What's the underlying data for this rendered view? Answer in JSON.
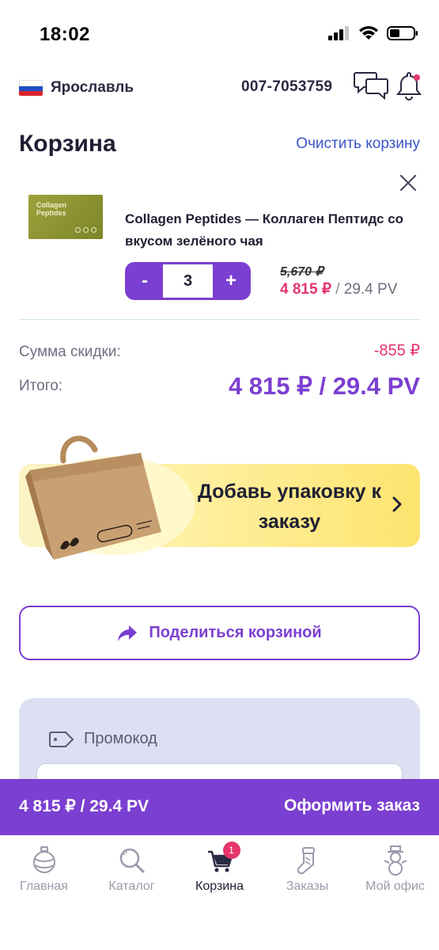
{
  "status_bar": {
    "time": "18:02"
  },
  "header": {
    "city": "Ярославль",
    "phone": "007-7053759"
  },
  "cart": {
    "title": "Корзина",
    "clear_label": "Очистить корзину",
    "item": {
      "thumb_text": "Collagen Peptides",
      "name": "Collagen Peptides — Коллаген Пептидс со вкусом зелёного чая",
      "quantity": "3",
      "minus_label": "-",
      "plus_label": "+",
      "old_price": "5,670 ₽",
      "price": "4 815 ₽",
      "price_separator": " / ",
      "pv": "29.4 PV"
    },
    "discount_label": "Сумма скидки:",
    "discount_value": "-855 ₽",
    "total_label": "Итого:",
    "total_value": "4 815 ₽ / 29.4 PV"
  },
  "package_banner": {
    "text": "Добавь упаковку к заказу"
  },
  "share": {
    "label": "Поделиться корзиной"
  },
  "promo": {
    "label": "Промокод",
    "value": ""
  },
  "checkout": {
    "total": "4 815 ₽ / 29.4 PV",
    "button_label": "Оформить заказ"
  },
  "bottom_nav": {
    "items": [
      {
        "label": "Главная",
        "icon": "ornament-icon"
      },
      {
        "label": "Каталог",
        "icon": "search-icon"
      },
      {
        "label": "Корзина",
        "icon": "cart-icon",
        "badge": "1",
        "active": true
      },
      {
        "label": "Заказы",
        "icon": "stocking-icon"
      },
      {
        "label": "Мой офис",
        "icon": "snowman-icon"
      }
    ]
  },
  "colors": {
    "accent": "#7b3fd1",
    "price": "#e6356b",
    "link": "#3a55c8"
  }
}
